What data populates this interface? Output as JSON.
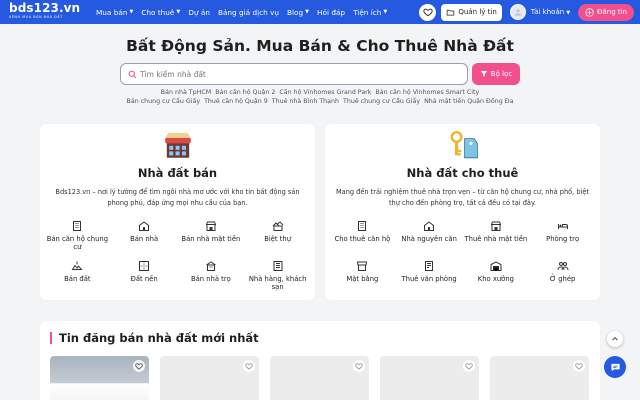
{
  "header": {
    "logo": "bds123.vn",
    "logo_sub": "KÊNH MUA BÁN NHÀ ĐẤT",
    "nav": [
      {
        "label": "Mua bán",
        "caret": true
      },
      {
        "label": "Cho thuê",
        "caret": true
      },
      {
        "label": "Dự án",
        "caret": false
      },
      {
        "label": "Bảng giá dịch vụ",
        "caret": false
      },
      {
        "label": "Blog",
        "caret": true
      },
      {
        "label": "Hỏi đáp",
        "caret": false
      },
      {
        "label": "Tiện ích",
        "caret": true
      }
    ],
    "manage_label": "Quản lý tin",
    "account_label": "Tài khoản",
    "post_label": "Đăng tin"
  },
  "hero": {
    "title": "Bất Động Sản. Mua Bán & Cho Thuê Nhà Đất",
    "search_placeholder": "Tìm kiếm nhà đất",
    "filter_label": "Bộ lọc",
    "tags_row1": [
      "Bán nhà TpHCM",
      "Bán căn hộ Quận 2",
      "Căn hộ Vinhomes Grand Park",
      "Bán căn hộ Vinhomes Smart City"
    ],
    "tags_row2": [
      "Bán chung cư Cầu Giấy",
      "Thuê căn hộ Quận 9",
      "Thuê nhà Bình Thạnh",
      "Thuê chung cư Cầu Giấy",
      "Nhà mặt tiền Quận Đống Đa"
    ]
  },
  "sale_card": {
    "title": "Nhà đất bán",
    "desc": "Bds123.vn – nơi lý tưởng để tìm ngôi nhà mơ ước với kho tin bất động sản phong phú, đáp ứng mọi nhu cầu của bạn.",
    "items": [
      {
        "label": "Bán căn hộ chung cư",
        "icon": "apartment-icon"
      },
      {
        "label": "Bán nhà",
        "icon": "house-icon"
      },
      {
        "label": "Bán nhà mặt tiền",
        "icon": "storefront-icon"
      },
      {
        "label": "Biệt thự",
        "icon": "villa-icon"
      },
      {
        "label": "Bán đất",
        "icon": "land-icon"
      },
      {
        "label": "Đất nền",
        "icon": "lot-icon"
      },
      {
        "label": "Bán nhà trọ",
        "icon": "boarding-house-icon"
      },
      {
        "label": "Nhà hàng, khách sạn",
        "icon": "hotel-icon"
      }
    ]
  },
  "rent_card": {
    "title": "Nhà đất cho thuê",
    "desc": "Mang đến trải nghiệm thuê nhà trọn vẹn – từ căn hộ chung cư, nhà phố, biệt thự cho đến phòng trọ, tất cả đều có tại đây.",
    "items": [
      {
        "label": "Cho thuê căn hộ",
        "icon": "apartment-icon"
      },
      {
        "label": "Nhà nguyên căn",
        "icon": "house-icon"
      },
      {
        "label": "Thuê nhà mặt tiền",
        "icon": "storefront-icon"
      },
      {
        "label": "Phòng trọ",
        "icon": "bed-icon"
      },
      {
        "label": "Mặt bằng",
        "icon": "shop-icon"
      },
      {
        "label": "Thuê văn phòng",
        "icon": "office-icon"
      },
      {
        "label": "Kho xưởng",
        "icon": "warehouse-icon"
      },
      {
        "label": "Ở ghép",
        "icon": "people-icon"
      }
    ]
  },
  "listings": {
    "title": "Tin đăng bán nhà đất mới nhất"
  },
  "colors": {
    "primary": "#2459e0",
    "accent": "#f2508c"
  }
}
